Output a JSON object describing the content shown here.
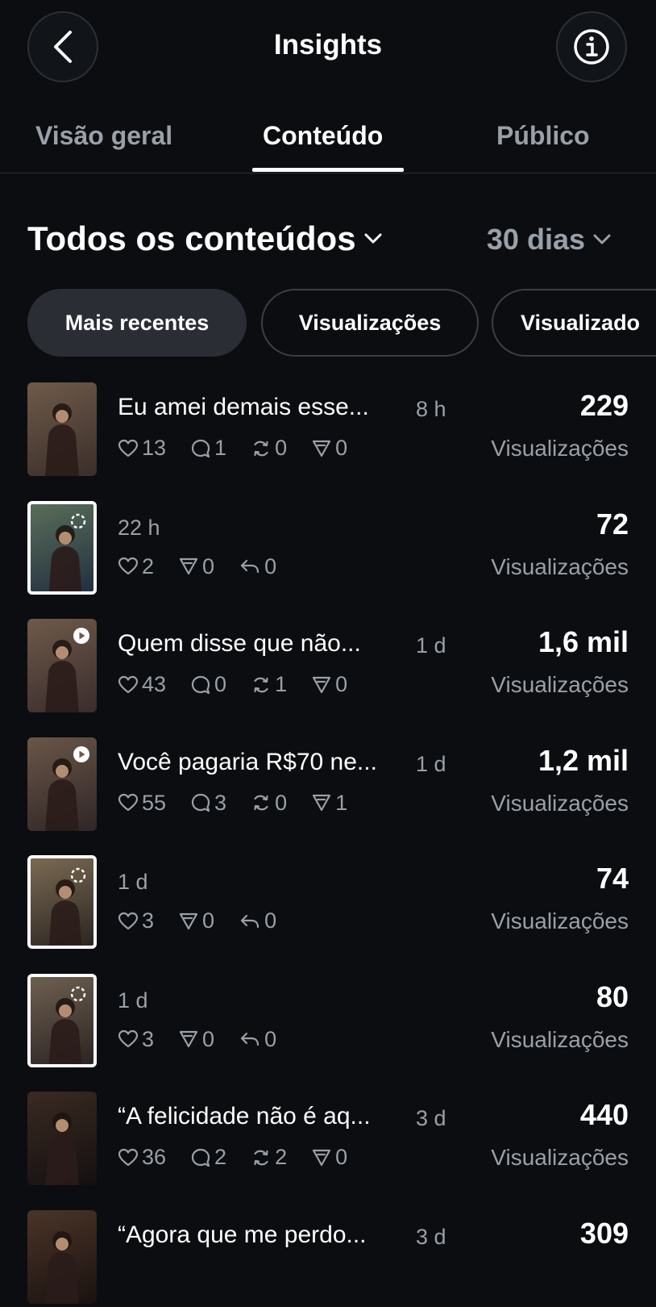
{
  "header": {
    "title": "Insights"
  },
  "tabs": [
    {
      "label": "Visão geral"
    },
    {
      "label": "Conteúdo"
    },
    {
      "label": "Público"
    }
  ],
  "filters": {
    "content_type": "Todos os conteúdos",
    "period": "30 dias"
  },
  "chips": [
    {
      "label": "Mais recentes"
    },
    {
      "label": "Visualizações"
    },
    {
      "label": "Visualizado"
    }
  ],
  "posts": [
    {
      "title": "Eu amei demais esse...",
      "age": "8 h",
      "views": "229",
      "views_label": "Visualizações",
      "likes": "13",
      "replies": "1",
      "reposts": "0",
      "shares": "0",
      "thumb": "photo",
      "thumb_colors": [
        "#6e5a4a",
        "#3b2e2a"
      ]
    },
    {
      "title": "",
      "age": "22 h",
      "views": "72",
      "views_label": "Visualizações",
      "likes": "2",
      "shares": "0",
      "quotes": "0",
      "thumb": "story",
      "thumb_colors": [
        "#5a6e5a",
        "#223040"
      ]
    },
    {
      "title": "Quem disse que não...",
      "age": "1 d",
      "views": "1,6 mil",
      "views_label": "Visualizações",
      "likes": "43",
      "replies": "0",
      "reposts": "1",
      "shares": "0",
      "thumb": "video",
      "thumb_colors": [
        "#6e5a4a",
        "#3a2c2c"
      ]
    },
    {
      "title": "Você pagaria R$70 ne...",
      "age": "1 d",
      "views": "1,2 mil",
      "views_label": "Visualizações",
      "likes": "55",
      "replies": "3",
      "reposts": "0",
      "shares": "1",
      "thumb": "video",
      "thumb_colors": [
        "#6a5648",
        "#2f2626"
      ]
    },
    {
      "title": "",
      "age": "1 d",
      "views": "74",
      "views_label": "Visualizações",
      "likes": "3",
      "shares": "0",
      "quotes": "0",
      "thumb": "story",
      "thumb_colors": [
        "#7a6a52",
        "#2b2622"
      ]
    },
    {
      "title": "",
      "age": "1 d",
      "views": "80",
      "views_label": "Visualizações",
      "likes": "3",
      "shares": "0",
      "quotes": "0",
      "thumb": "story",
      "thumb_colors": [
        "#6e6050",
        "#2c2424"
      ]
    },
    {
      "title": "“A felicidade não é aq...",
      "age": "3 d",
      "views": "440",
      "views_label": "Visualizações",
      "likes": "36",
      "replies": "2",
      "reposts": "2",
      "shares": "0",
      "thumb": "photo",
      "thumb_colors": [
        "#3a2a22",
        "#141010"
      ]
    },
    {
      "title": "“Agora que me perdo...",
      "age": "3 d",
      "views": "309",
      "views_label": "",
      "thumb": "photo",
      "thumb_colors": [
        "#4a3428",
        "#1a1210"
      ]
    }
  ],
  "colors": {
    "background": "#0b0d10",
    "muted": "#9aa0a8",
    "chip_active": "#2a2d33"
  }
}
